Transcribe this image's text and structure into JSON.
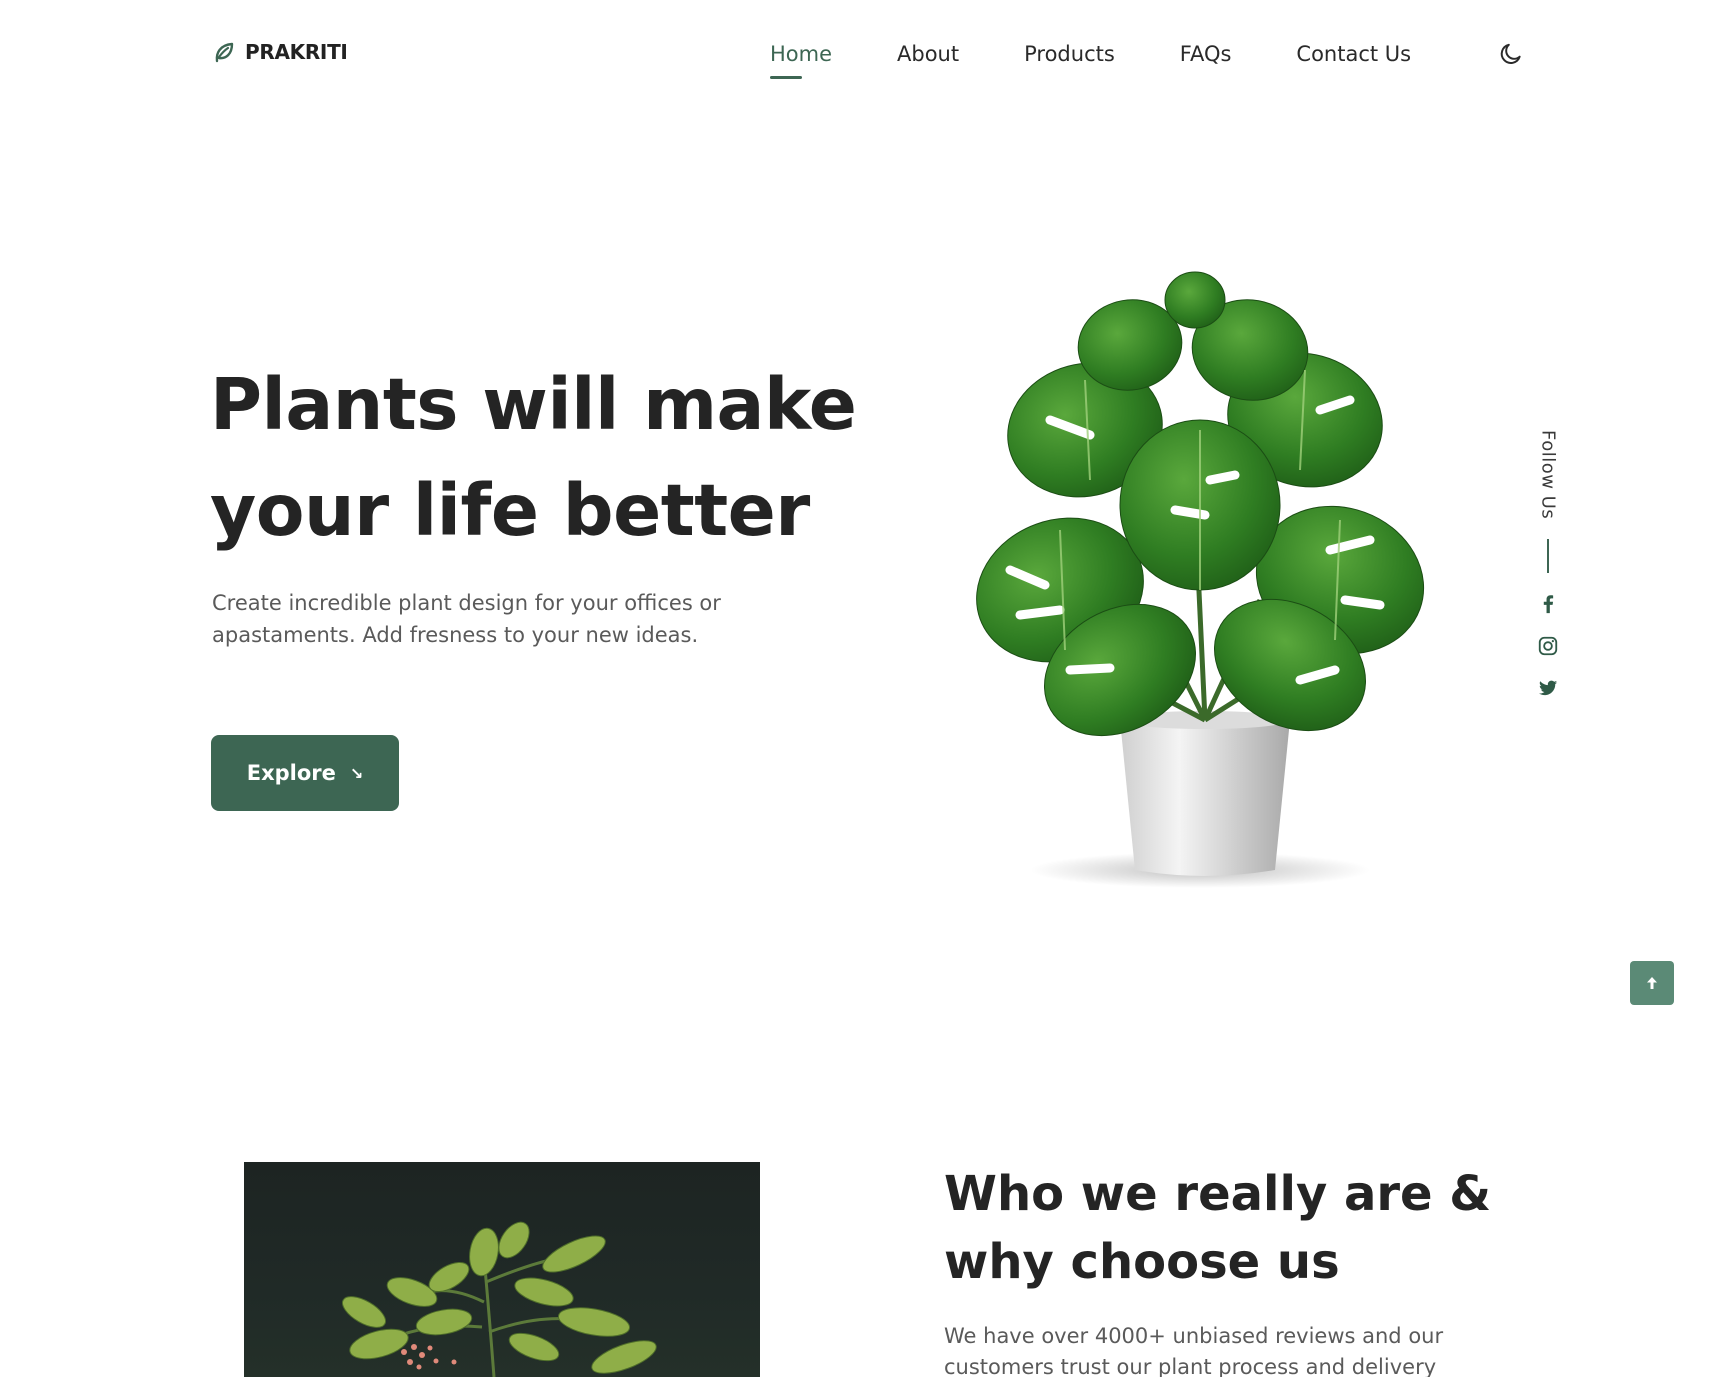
{
  "brand": {
    "name": "PRAKRITI",
    "icon": "leaf-icon"
  },
  "nav": {
    "items": [
      "Home",
      "About",
      "Products",
      "FAQs",
      "Contact Us"
    ],
    "active": "Home",
    "theme_icon": "moon-icon"
  },
  "hero": {
    "title_line1": "Plants will make",
    "title_line2": "your life better",
    "description": "Create incredible plant design for your offices or apastaments. Add fresness to your new ideas.",
    "cta_label": "Explore",
    "cta_icon": "arrow-down-right-icon"
  },
  "follow": {
    "label": "Follow Us",
    "socials": [
      "facebook-icon",
      "instagram-icon",
      "twitter-icon"
    ]
  },
  "scroll_top": {
    "icon": "arrow-up-icon"
  },
  "about": {
    "title_line1": "Who we really are &",
    "title_line2": "why choose us",
    "text": "We have over 4000+ unbiased reviews and our customers trust our plant process and delivery"
  },
  "colors": {
    "accent": "#3d6653",
    "scroll_button": "#5b8a76",
    "heading": "#242424",
    "body_text": "#5a5a5a"
  }
}
